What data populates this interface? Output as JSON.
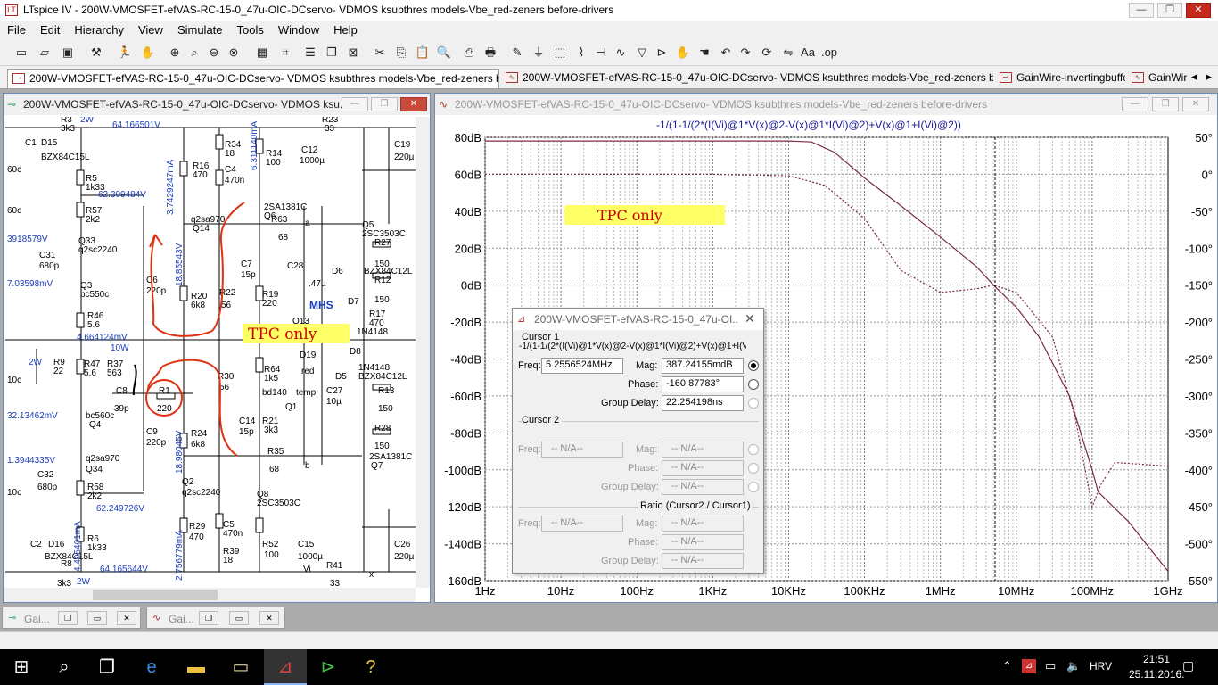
{
  "app": {
    "title": "LTspice IV - 200W-VMOSFET-efVAS-RC-15-0_47u-OIC-DCservo- VDMOS ksubthres models-Vbe_red-zeners before-drivers"
  },
  "menu": [
    "File",
    "Edit",
    "Hierarchy",
    "View",
    "Simulate",
    "Tools",
    "Window",
    "Help"
  ],
  "tabs": [
    {
      "label": "200W-VMOSFET-efVAS-RC-15-0_47u-OIC-DCservo- VDMOS ksubthres models-Vbe_red-zeners before-drivers"
    },
    {
      "label": "200W-VMOSFET-efVAS-RC-15-0_47u-OIC-DCservo- VDMOS ksubthres models-Vbe_red-zeners before-drivers"
    },
    {
      "label": "GainWire-invertingbuffer"
    },
    {
      "label": "GainWir"
    }
  ],
  "schematic_window": {
    "title": "200W-VMOSFET-efVAS-RC-15-0_47u-OIC-DCservo- VDMOS ksu...",
    "annotations": [
      "TPC only",
      "MHS"
    ],
    "labels": {
      "v1": "64.166501V",
      "v2": "62.309484V",
      "v3": "3918579V",
      "v4": "7.03598mV",
      "v5": "4.664124mV",
      "v6": "32.13462mV",
      "v7": "1.3944335V",
      "v8": "62.249726V",
      "v9": "64.165644V",
      "i1": "3.7429247mA",
      "i2": "18.85543V",
      "i3": "18.98045V",
      "i4": "2.756779mA",
      "i5": "4.405401mA",
      "i6": "6.311140mA",
      "p1": "2W",
      "p2": "10W",
      "p3": "2W",
      "p4": "2W",
      "parts": [
        "C1",
        "D15",
        "R3",
        "3k3",
        "BZX84C15L",
        "R5",
        "1k33",
        "R57",
        "2k2",
        "Q33",
        "q2sc2240",
        "C31",
        "680p",
        "Q3",
        "bc550c",
        "R46",
        "5.6",
        "R9",
        "22",
        "R47",
        "5.6",
        "R37",
        "563",
        "C8",
        "39p",
        "R1",
        "220",
        "bc560c",
        "Q4",
        "C9",
        "220p",
        "q2sa970",
        "Q34",
        "C32",
        "680p",
        "R58",
        "2k2",
        "R6",
        "1k33",
        "C2",
        "D16",
        "BZX84C15L",
        "R8",
        "3k3",
        "R16",
        "470",
        "R34",
        "18",
        "C4",
        "470n",
        "R14",
        "100",
        "C12",
        "1000µ",
        "R23",
        "33",
        "C19",
        "220µ",
        "q2sa970",
        "Q14",
        "2SA1381C",
        "Q6",
        "R63",
        "68",
        "C6",
        "220p",
        "R20",
        "6k8",
        "C7",
        "15p",
        "R22",
        "56",
        "R19",
        "220",
        "C28",
        ".47µ",
        "Q5",
        "2SC3503C",
        "R27",
        "150",
        "BZX84C12L",
        "R12",
        "150",
        "D6",
        "D7",
        "R17",
        "470",
        "1N4148",
        "Q13",
        "D19",
        "red",
        "D8",
        "1N4148",
        "D5",
        "BZX84C12L",
        "R30",
        "56",
        "R64",
        "1k5",
        "bd140",
        "temp",
        "C27",
        "10µ",
        "Q1",
        "R13",
        "150",
        "R28",
        "150",
        "C14",
        "15p",
        "R21",
        "3k3",
        "R24",
        "6k8",
        "R35",
        "68",
        "2SA1381C",
        "Q7",
        "Q2",
        "q2sc2240",
        "Q8",
        "2SC3503C",
        "C5",
        "470n",
        "R39",
        "18",
        "R29",
        "470",
        "R52",
        "100",
        "C15",
        "1000µ",
        "R41",
        "33",
        "C26",
        "220µ",
        "Vi",
        "a",
        "b",
        "x",
        "60c",
        "60c",
        "10c",
        "10c"
      ]
    }
  },
  "waveform_window": {
    "title": "200W-VMOSFET-efVAS-RC-15-0_47u-OIC-DCservo- VDMOS ksubthres models-Vbe_red-zeners before-drivers",
    "trace_expr": "-1/(1-1/(2*(I(Vi)@1*V(x)@2-V(x)@1*I(Vi)@2)+V(x)@1+I(Vi)@2))",
    "annotation": "TPC only"
  },
  "chart_data": {
    "type": "line",
    "title": "-1/(1-1/(2*(I(Vi)@1*V(x)@2-V(x)@1*I(Vi)@2)+V(x)@1+I(Vi)@2))",
    "x_scale": "log",
    "x_ticks": [
      "1Hz",
      "10Hz",
      "100Hz",
      "1KHz",
      "10KHz",
      "100KHz",
      "1MHz",
      "10MHz",
      "100MHz",
      "1GHz"
    ],
    "y_left_ticks": [
      "80dB",
      "60dB",
      "40dB",
      "20dB",
      "0dB",
      "-20dB",
      "-40dB",
      "-60dB",
      "-80dB",
      "-100dB",
      "-120dB",
      "-140dB",
      "-160dB"
    ],
    "y_right_ticks": [
      "50°",
      "0°",
      "-50°",
      "-100°",
      "-150°",
      "-200°",
      "-250°",
      "-300°",
      "-350°",
      "-400°",
      "-450°",
      "-500°",
      "-550°"
    ],
    "xlim_hz": [
      1,
      1000000000
    ],
    "ylim_db": [
      -160,
      80
    ],
    "ylim_deg": [
      -550,
      50
    ],
    "grid": true,
    "series": [
      {
        "kind": "magnitude",
        "color": "#7a2a4a",
        "x": [
          1,
          1000,
          10000,
          20000,
          40000,
          100000,
          300000,
          1000000,
          3000000,
          5000000,
          10000000,
          20000000,
          50000000,
          100000000,
          120000000,
          300000000,
          1000000000
        ],
        "y": [
          78,
          78,
          78,
          77.5,
          72,
          58,
          43,
          26,
          10,
          0,
          -12,
          -28,
          -60,
          -100,
          -112,
          -128,
          -155
        ]
      },
      {
        "kind": "phase",
        "color": "#7a2a4a",
        "x": [
          1,
          1000,
          10000,
          30000,
          100000,
          300000,
          1000000,
          3000000,
          5000000,
          10000000,
          30000000,
          60000000,
          100000000,
          130000000,
          200000000,
          1000000000
        ],
        "y": [
          0,
          0,
          -2,
          -15,
          -60,
          -130,
          -160,
          -155,
          -150,
          -160,
          -220,
          -330,
          -450,
          -420,
          -390,
          -395
        ]
      }
    ],
    "cursor_x_hz": 5255652.4
  },
  "cursor_dialog": {
    "title": "200W-VMOSFET-efVAS-RC-15-0_47u-OI...",
    "cursor1_label": "Cursor 1",
    "cursor1_expr": "-1/(1-1/(2*(I(Vi)@1*V(x)@2-V(x)@1*I(Vi)@2)+V(x)@1+I(Vi)",
    "freq_label": "Freq:",
    "freq": "5.2556524MHz",
    "mag_label": "Mag:",
    "mag": "387.24155mdB",
    "phase_label": "Phase:",
    "phase": "-160.87783°",
    "gd_label": "Group Delay:",
    "gd": "22.254198ns",
    "cursor2_label": "Cursor 2",
    "na": "-- N/A--",
    "ratio_label": "Ratio (Cursor2 / Cursor1)"
  },
  "minimized": [
    {
      "label": "Gai..."
    },
    {
      "label": "Gai..."
    }
  ],
  "taskbar": {
    "lang": "HRV",
    "time": "21:51",
    "date": "25.11.2016."
  }
}
